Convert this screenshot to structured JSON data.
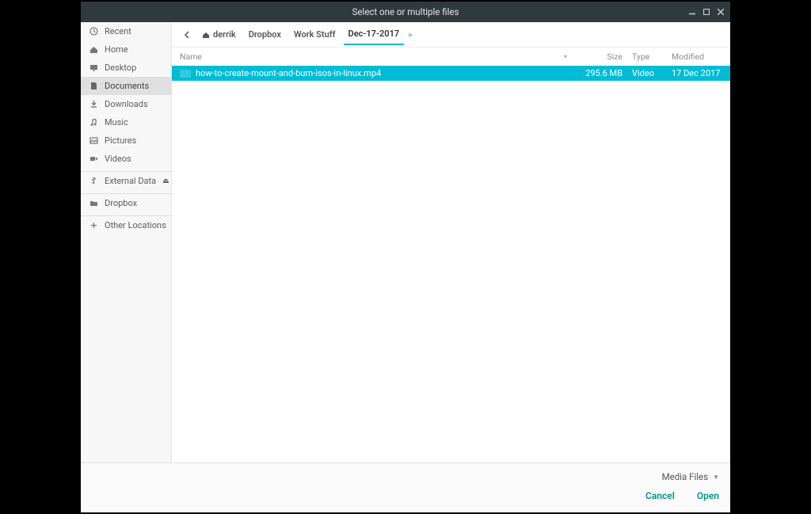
{
  "window": {
    "title": "Select one or multiple files"
  },
  "sidebar": {
    "items": [
      {
        "label": "Recent",
        "icon": "clock-icon"
      },
      {
        "label": "Home",
        "icon": "home-icon"
      },
      {
        "label": "Desktop",
        "icon": "desktop-icon"
      },
      {
        "label": "Documents",
        "icon": "document-icon"
      },
      {
        "label": "Downloads",
        "icon": "download-icon"
      },
      {
        "label": "Music",
        "icon": "music-icon"
      },
      {
        "label": "Pictures",
        "icon": "pictures-icon"
      },
      {
        "label": "Videos",
        "icon": "video-icon"
      },
      {
        "label": "External Data",
        "icon": "usb-icon",
        "eject": true
      },
      {
        "label": "Dropbox",
        "icon": "folder-icon"
      },
      {
        "label": "Other Locations",
        "icon": "plus-icon"
      }
    ]
  },
  "breadcrumb": {
    "items": [
      "derrik",
      "Dropbox",
      "Work Stuff",
      "Dec-17-2017"
    ]
  },
  "columns": {
    "name": "Name",
    "size": "Size",
    "type": "Type",
    "modified": "Modified"
  },
  "rows": [
    {
      "name": "how-to-create-mount-and-burn-isos-in-linux.mp4",
      "size": "295.6 MB",
      "type": "Video",
      "modified": "17 Dec 2017"
    }
  ],
  "footer": {
    "filter_label": "Media Files",
    "cancel_label": "Cancel",
    "open_label": "Open"
  }
}
